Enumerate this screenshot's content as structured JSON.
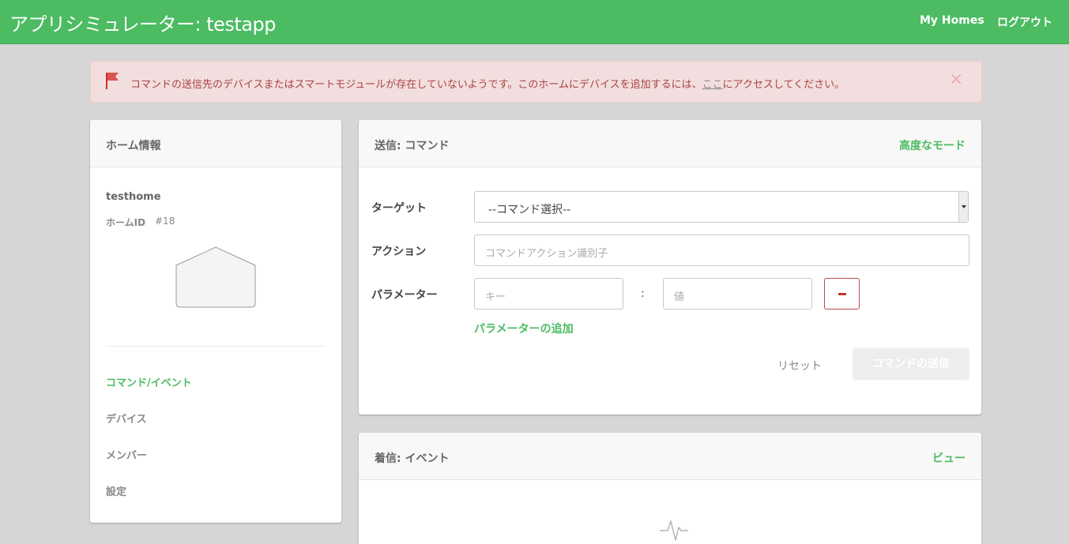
{
  "header": {
    "title": "アプリシミュレーター: testapp",
    "nav": {
      "my_homes": "My Homes",
      "logout": "ログアウト"
    }
  },
  "alert": {
    "message_before": "コマンドの送信先のデバイスまたはスマートモジュールが存在していないようです。このホームにデバイスを追加するには、",
    "link_text": "ここ",
    "message_after": "にアクセスしてください。",
    "close_symbol": "×"
  },
  "home_info": {
    "panel_title": "ホーム情報",
    "home_name": "testhome",
    "home_id_label": "ホームID",
    "home_id_value": "#18",
    "nav": {
      "commands_events": "コマンド/イベント",
      "devices": "デバイス",
      "members": "メンバー",
      "settings": "設定"
    }
  },
  "command_panel": {
    "title": "送信: コマンド",
    "advanced_mode": "高度なモード",
    "target_label": "ターゲット",
    "target_selected": "--コマンド選択--",
    "action_label": "アクション",
    "action_placeholder": "コマンドアクション識別子",
    "params_label": "パラメーター",
    "key_placeholder": "キー",
    "separator": ":",
    "value_placeholder": "値",
    "add_param": "パラメーターの追加",
    "reset": "リセット",
    "send": "コマンドの送信"
  },
  "event_panel": {
    "title": "着信: イベント",
    "view": "ビュー"
  },
  "colors": {
    "brand_green": "#4cbb62",
    "alert_bg": "#f2dede",
    "alert_text": "#a94442",
    "danger": "#c0392b",
    "page_bg": "#d6d6d6"
  },
  "icons": [
    "flag-icon",
    "close-icon",
    "home-icon",
    "caret-down-icon",
    "minus-icon",
    "pulse-icon"
  ]
}
